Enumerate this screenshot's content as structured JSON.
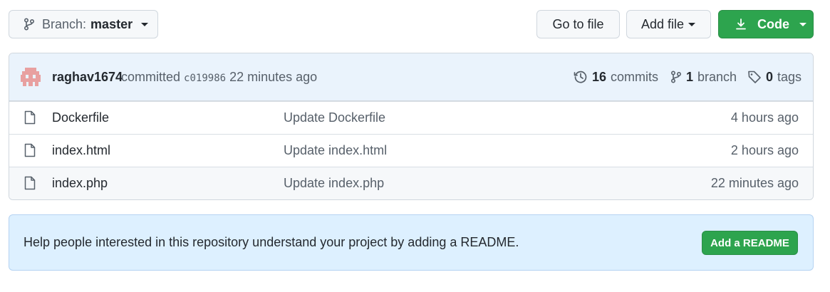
{
  "toolbar": {
    "branch_prefix": "Branch:",
    "branch_name": "master",
    "go_to_file": "Go to file",
    "add_file": "Add file",
    "code": "Code"
  },
  "commit": {
    "author": "raghav1674",
    "action": "committed",
    "sha": "c019986",
    "time": "22 minutes ago",
    "commits_count": "16",
    "commits_label": "commits",
    "branch_count": "1",
    "branch_label": "branch",
    "tag_count": "0",
    "tag_label": "tags"
  },
  "files": [
    {
      "name": "Dockerfile",
      "message": "Update Dockerfile",
      "age": "4 hours ago"
    },
    {
      "name": "index.html",
      "message": "Update index.html",
      "age": "2 hours ago"
    },
    {
      "name": "index.php",
      "message": "Update index.php",
      "age": "22 minutes ago"
    }
  ],
  "readme": {
    "text": "Help people interested in this repository understand your project by adding a README.",
    "button": "Add a README"
  },
  "colors": {
    "accent_green": "#2da44e",
    "commit_bar_bg": "#eaf3fc",
    "readme_bg": "#ddf0ff"
  }
}
